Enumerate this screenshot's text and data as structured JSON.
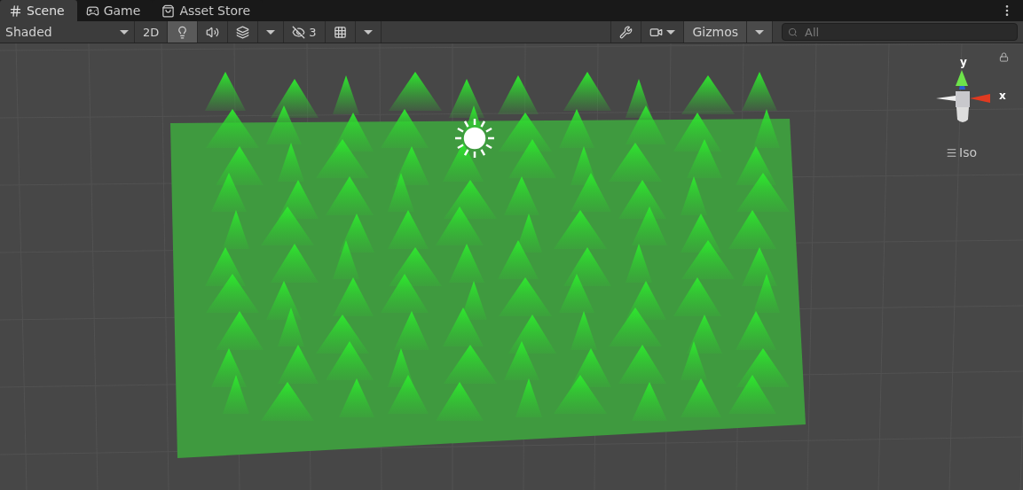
{
  "tabs": [
    {
      "label": "Scene",
      "kind": "scene",
      "selected": true
    },
    {
      "label": "Game",
      "kind": "game",
      "selected": false
    },
    {
      "label": "Asset Store",
      "kind": "store",
      "selected": false
    }
  ],
  "toolbar": {
    "draw_mode": "Shaded",
    "mode_2d": {
      "label": "2D",
      "on": false
    },
    "toggles": [
      {
        "kind": "lighting",
        "on": true
      },
      {
        "kind": "audio",
        "on": false
      },
      {
        "kind": "effects",
        "on": false
      }
    ],
    "hidden_count": "3",
    "gizmos": "Gizmos",
    "search": {
      "placeholder": "All"
    }
  },
  "gizmo": {
    "y_label": "y",
    "x_label": "x",
    "projection": "Iso"
  }
}
